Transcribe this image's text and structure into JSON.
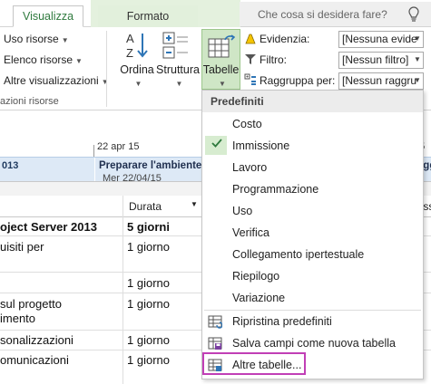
{
  "tabs": {
    "visualizza": "Visualizza",
    "formato": "Formato",
    "search_placeholder": "Che cosa si desidera fare?"
  },
  "ribbon": {
    "uso_risorse": "Uso risorse",
    "elenco_risorse": "Elenco risorse",
    "altre_visualizzazioni": "Altre visualizzazioni",
    "group_label": "azioni risorse",
    "ordina": "Ordina",
    "struttura": "Struttura",
    "tabelle": "Tabelle",
    "evidenzia_label": "Evidenzia:",
    "evidenzia_value": "[Nessuna evide",
    "filtro_label": "Filtro:",
    "filtro_value": "[Nessun filtro]",
    "raggruppa_label": "Raggruppa per:",
    "raggruppa_value": "[Nessun raggru"
  },
  "timeline": {
    "date1": "22 apr 15",
    "date2": "15",
    "year": "013",
    "task": "Preparare l'ambiente",
    "task_date": "Mer 22/04/15",
    "task2": "Agg"
  },
  "grid": {
    "col_duration": "Durata",
    "col_right": "ecess",
    "rows": [
      {
        "name": "oject Server 2013",
        "name2": "",
        "duration": "5 giorni",
        "bold": true
      },
      {
        "name": "uisiti per",
        "name2": "",
        "duration": "1 giorno"
      },
      {
        "name": "",
        "name2": "",
        "duration": "1 giorno"
      },
      {
        "name": "sul progetto",
        "name2": "imento",
        "duration": "1 giorno"
      },
      {
        "name": "sonalizzazioni",
        "name2": "",
        "duration": "1 giorno"
      },
      {
        "name": "omunicazioni",
        "name2": "",
        "duration": "1 giorno"
      }
    ]
  },
  "menu": {
    "header": "Predefiniti",
    "items": [
      "Costo",
      "Immissione",
      "Lavoro",
      "Programmazione",
      "Uso",
      "Verifica",
      "Collegamento ipertestuale",
      "Riepilogo",
      "Variazione"
    ],
    "selected": "Immissione",
    "actions": [
      "Ripristina predefiniti",
      "Salva campi come nuova tabella",
      "Altre tabelle..."
    ]
  },
  "colors": {
    "accent_green": "#2f7a3e",
    "tab_green_bg": "#e4f1de",
    "timeline_band": "#dde9f6",
    "highlight": "#c13fb6"
  }
}
